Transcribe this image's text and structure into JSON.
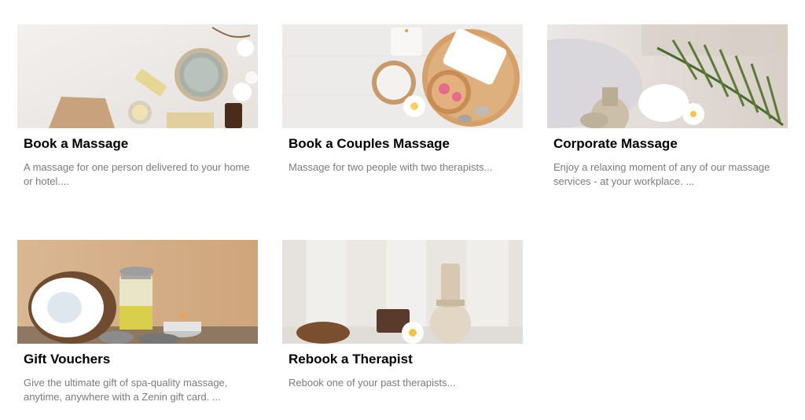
{
  "services": [
    {
      "title": "Book a Massage",
      "description": "A massage for one person delivered to your home or hotel....",
      "image_icon": "massage-essentials-image"
    },
    {
      "title": "Book a Couples Massage",
      "description": "Massage for two people with two therapists...",
      "image_icon": "couples-spa-tray-image"
    },
    {
      "title": "Corporate Massage",
      "description": "Enjoy a relaxing moment of any of our massage services - at your workplace. ...",
      "image_icon": "spa-towel-palm-image"
    },
    {
      "title": "Gift Vouchers",
      "description": "Give the ultimate gift of spa-quality massage, anytime, anywhere with a Zenin gift card. ...",
      "image_icon": "coconut-oil-candle-image"
    },
    {
      "title": "Rebook a Therapist",
      "description": "Rebook one of your past therapists...",
      "image_icon": "herbal-compress-image"
    }
  ]
}
